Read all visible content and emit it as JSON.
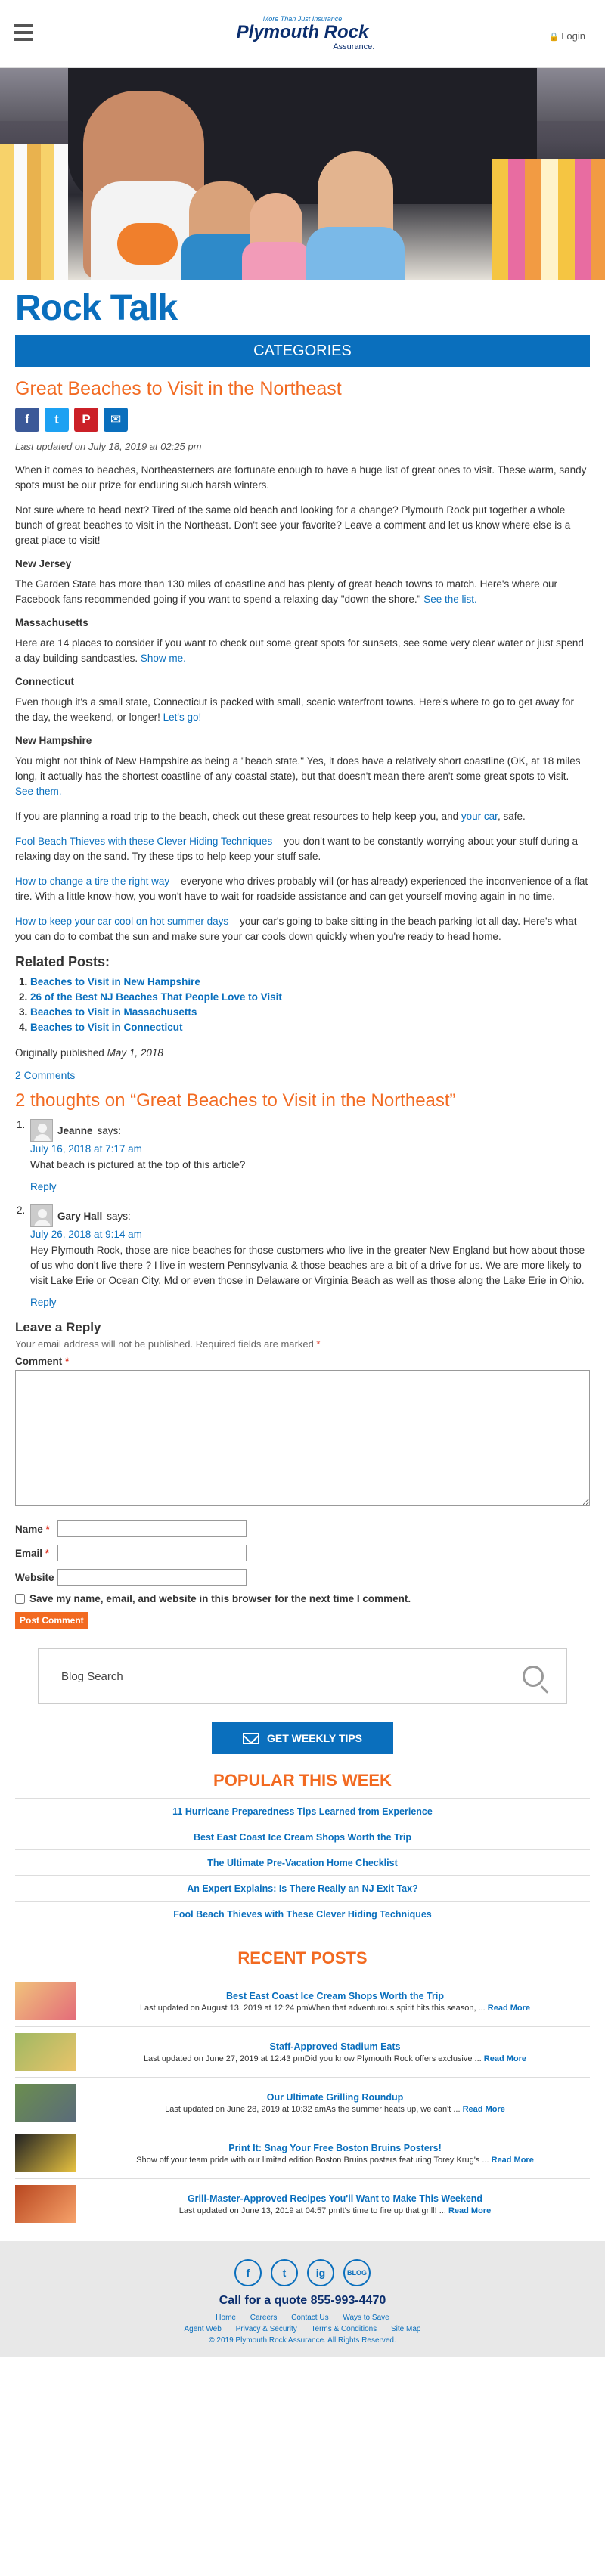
{
  "header": {
    "tagline": "More Than Just Insurance",
    "brand": "Plymouth Rock",
    "brand_sub": "Assurance.",
    "login": "Login"
  },
  "blog": {
    "title": "Rock Talk",
    "categories_label": "CATEGORIES"
  },
  "post": {
    "title": "Great Beaches to Visit in the Northeast",
    "share": [
      "f",
      "t",
      "P",
      "✉"
    ],
    "updated": "Last updated on July 18, 2019 at 02:25 pm",
    "intro1": "When it comes to beaches, Northeasterners are fortunate enough to have a huge list of great ones to visit. These warm, sandy spots must be our prize for enduring such harsh winters.",
    "intro2": "Not sure where to head next? Tired of the same old beach and looking for a change? Plymouth Rock put together a whole bunch of great beaches to visit in the Northeast. Don't see your favorite? Leave a comment and let us know where else is a great place to visit!",
    "nj_h": "New Jersey",
    "nj_text": "The Garden State has more than 130 miles of coastline and has plenty of great beach towns to match. Here's where our Facebook fans recommended going if you want to spend a relaxing day \"down the shore.\"",
    "nj_link": "See the list.",
    "ma_h": "Massachusetts",
    "ma_text": "Here are 14 places to consider if you want to check out some great spots for sunsets, see some very clear water or just spend a day building sandcastles.",
    "ma_link": "Show me.",
    "ct_h": "Connecticut",
    "ct_text": "Even though it's a small state, Connecticut is packed with small, scenic waterfront towns. Here's where to go to get away for the day, the weekend, or longer!",
    "ct_link": "Let's go!",
    "nh_h": "New Hampshire",
    "nh_text": "You might not think of New Hampshire as being a \"beach state.\" Yes, it does have a relatively short coastline (OK, at 18 miles long, it actually has the shortest coastline of any coastal state), but that doesn't mean there aren't some great spots to visit.",
    "nh_link": "See them.",
    "trip_text": "If you are planning a road trip to the beach, check out these great resources to help keep you, and",
    "trip_link": "your car",
    "trip_end": ", safe.",
    "thieves_link": "Fool Beach Thieves with these Clever Hiding Techniques",
    "thieves_text": " – you don't want to be constantly worrying about your stuff during a relaxing day on the sand. Try these tips to help keep your stuff safe.",
    "tire_link": "How to change a tire the right way",
    "tire_text": " – everyone who drives probably will (or has already) experienced the inconvenience of a flat tire. With a little know-how, you won't have to wait for roadside assistance and can get yourself moving again in no time.",
    "cool_link": "How to keep your car cool on hot summer days",
    "cool_text": " – your car's going to bake sitting in the beach parking lot all day. Here's what you can do to combat the sun and make sure your car cools down quickly when you're ready to head home.",
    "related_title": "Related Posts:",
    "related": [
      "Beaches to Visit in New Hampshire",
      "26 of the Best NJ Beaches That People Love to Visit",
      "Beaches to Visit in Massachusetts",
      "Beaches to Visit in Connecticut"
    ],
    "orig_label": "Originally published",
    "orig_date": "May 1, 2018",
    "comment_count": "2 Comments"
  },
  "comments": {
    "title": "2 thoughts on “Great Beaches to Visit in the Northeast”",
    "items": [
      {
        "num": "1.",
        "author": "Jeanne",
        "says": "says:",
        "date": "July 16, 2018 at 7:17 am",
        "text": "What beach is pictured at the top of this article?",
        "reply": "Reply"
      },
      {
        "num": "2.",
        "author": "Gary Hall",
        "says": "says:",
        "date": "July 26, 2018 at 9:14 am",
        "text": "Hey Plymouth Rock, those are nice beaches for those customers who live in the greater New England but how about those of us who don't live there ? I live in western Pennsylvania & those beaches are a bit of a drive for us. We are more likely to visit Lake Erie or Ocean City, Md or even those in Delaware or Virginia Beach as well as those along the Lake Erie in Ohio.",
        "reply": "Reply"
      }
    ]
  },
  "form": {
    "title": "Leave a Reply",
    "note": "Your email address will not be published. Required fields are marked",
    "req": "*",
    "comment_label": "Comment",
    "name_label": "Name",
    "email_label": "Email",
    "website_label": "Website",
    "save_label": "Save my name, email, and website in this browser for the next time I comment.",
    "submit": "Post Comment"
  },
  "sidebar": {
    "search_placeholder": "Blog Search",
    "weekly_label": "GET WEEKLY TIPS",
    "popular_title": "POPULAR THIS WEEK",
    "popular": [
      "11 Hurricane Preparedness Tips Learned from Experience",
      "Best East Coast Ice Cream Shops Worth the Trip",
      "The Ultimate Pre-Vacation Home Checklist",
      "An Expert Explains: Is There Really an NJ Exit Tax?",
      "Fool Beach Thieves with These Clever Hiding Techniques"
    ],
    "recent_title": "RECENT POSTS",
    "recent": [
      {
        "title": "Best East Coast Ice Cream Shops Worth the Trip",
        "desc": "Last updated on August 13, 2019 at 12:24 pmWhen that adventurous spirit hits this season, ...",
        "more": "Read More"
      },
      {
        "title": "Staff-Approved Stadium Eats",
        "desc": "Last updated on June 27, 2019 at 12:43 pmDid you know Plymouth Rock offers exclusive ...",
        "more": "Read More"
      },
      {
        "title": "Our Ultimate Grilling Roundup",
        "desc": "Last updated on June 28, 2019 at 10:32 amAs the summer heats up, we can't ...",
        "more": "Read More"
      },
      {
        "title": "Print It: Snag Your Free Boston Bruins Posters!",
        "desc": "Show off your team pride with our limited edition Boston Bruins posters featuring Torey Krug's ...",
        "more": "Read More"
      },
      {
        "title": "Grill-Master-Approved Recipes You'll Want to Make This Weekend",
        "desc": "Last updated on June 13, 2019 at 04:57 pmIt's time to fire up that grill! ...",
        "more": "Read More"
      }
    ]
  },
  "footer": {
    "social": [
      "f",
      "t",
      "ig",
      "BLOG"
    ],
    "call": "Call for a quote 855-993-4470",
    "links_row1": [
      "Home",
      "Careers",
      "Contact Us",
      "Ways to Save"
    ],
    "links_row2": [
      "Agent Web",
      "Privacy & Security",
      "Terms & Conditions",
      "Site Map"
    ],
    "copyright": "© 2019 Plymouth Rock Assurance. All Rights Reserved."
  }
}
